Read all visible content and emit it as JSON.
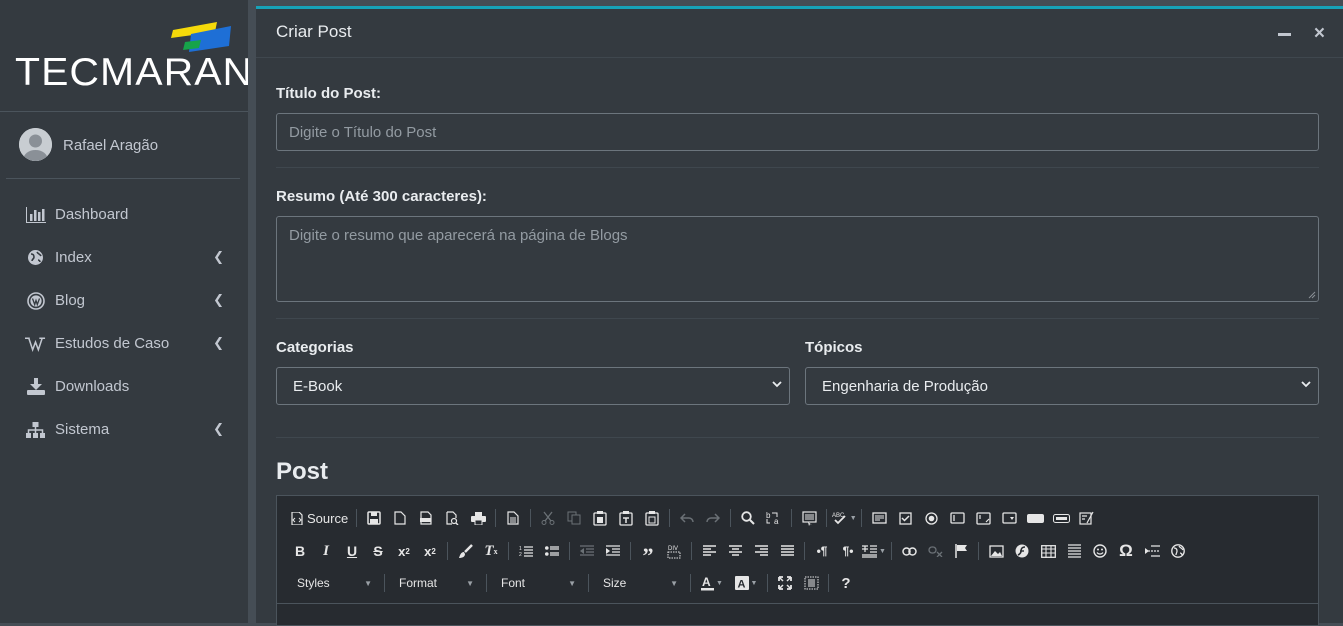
{
  "brand": {
    "name": "TECMARAN"
  },
  "user": {
    "name": "Rafael Aragão"
  },
  "nav": [
    {
      "label": "Dashboard",
      "icon": "bar-chart-icon",
      "expandable": false
    },
    {
      "label": "Index",
      "icon": "globe-icon",
      "expandable": true
    },
    {
      "label": "Blog",
      "icon": "wordpress-icon",
      "expandable": true
    },
    {
      "label": "Estudos de Caso",
      "icon": "wikipedia-icon",
      "expandable": true
    },
    {
      "label": "Downloads",
      "icon": "download-icon",
      "expandable": false
    },
    {
      "label": "Sistema",
      "icon": "sitemap-icon",
      "expandable": true
    }
  ],
  "card": {
    "title": "Criar Post"
  },
  "form": {
    "title_label": "Título do Post:",
    "title_placeholder": "Digite o Título do Post",
    "summary_label": "Resumo (Até 300 caracteres):",
    "summary_placeholder": "Digite o resumo que aparecerá na página de Blogs",
    "categories_label": "Categorias",
    "categories_value": "E-Book",
    "topics_label": "Tópicos",
    "topics_value": "Engenharia de Produção",
    "post_label": "Post"
  },
  "editor": {
    "source_label": "Source",
    "combos": [
      "Styles",
      "Format",
      "Font",
      "Size"
    ]
  },
  "colors": {
    "sidebar_bg": "#343a40",
    "content_bg": "#454d55",
    "card_accent": "#17a2b8",
    "editor_bg": "#272b30"
  }
}
